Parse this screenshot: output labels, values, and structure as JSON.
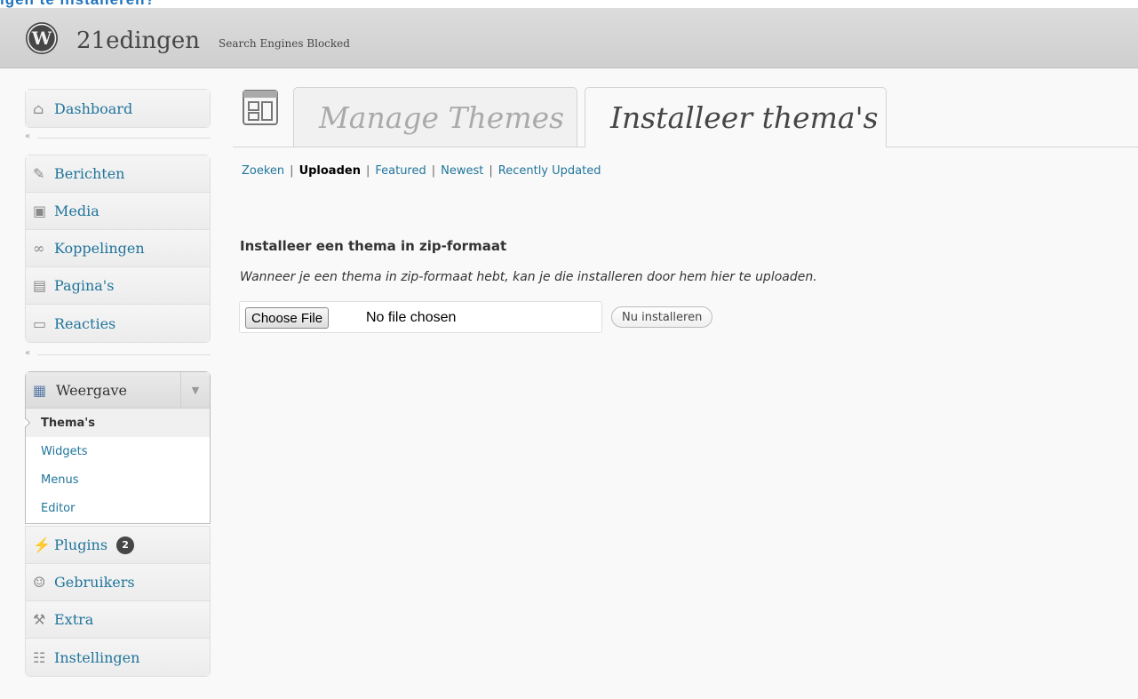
{
  "top_strip_text": "igen te installeren?",
  "header": {
    "site_name": "21edingen",
    "site_status": "Search Engines Blocked"
  },
  "sidebar": {
    "dashboard": "Dashboard",
    "content_items": [
      {
        "label": "Berichten",
        "icon": "pushpin-icon"
      },
      {
        "label": "Media",
        "icon": "media-icon"
      },
      {
        "label": "Koppelingen",
        "icon": "link-icon"
      },
      {
        "label": "Pagina's",
        "icon": "pages-icon"
      },
      {
        "label": "Reacties",
        "icon": "comments-icon"
      }
    ],
    "appearance": {
      "label": "Weergave",
      "submenu": [
        "Thema's",
        "Widgets",
        "Menus",
        "Editor"
      ],
      "current": "Thema's"
    },
    "plugins": {
      "label": "Plugins",
      "badge": "2"
    },
    "users": "Gebruikers",
    "tools": "Extra",
    "settings": "Instellingen"
  },
  "tabs": {
    "manage": "Manage Themes",
    "install": "Installeer thema's"
  },
  "subnav": {
    "items": [
      "Zoeken",
      "Uploaden",
      "Featured",
      "Newest",
      "Recently Updated"
    ],
    "current": "Uploaden"
  },
  "upload": {
    "heading": "Installeer een thema in zip-formaat",
    "description": "Wanneer je een thema in zip-formaat hebt, kan je die installeren door hem hier te uploaden.",
    "choose_file": "Choose File",
    "no_file": "No file chosen",
    "install_button": "Nu installeren"
  },
  "colors": {
    "link": "#21759b",
    "background": "#f9f9f9",
    "header": "#d4d4d4"
  }
}
